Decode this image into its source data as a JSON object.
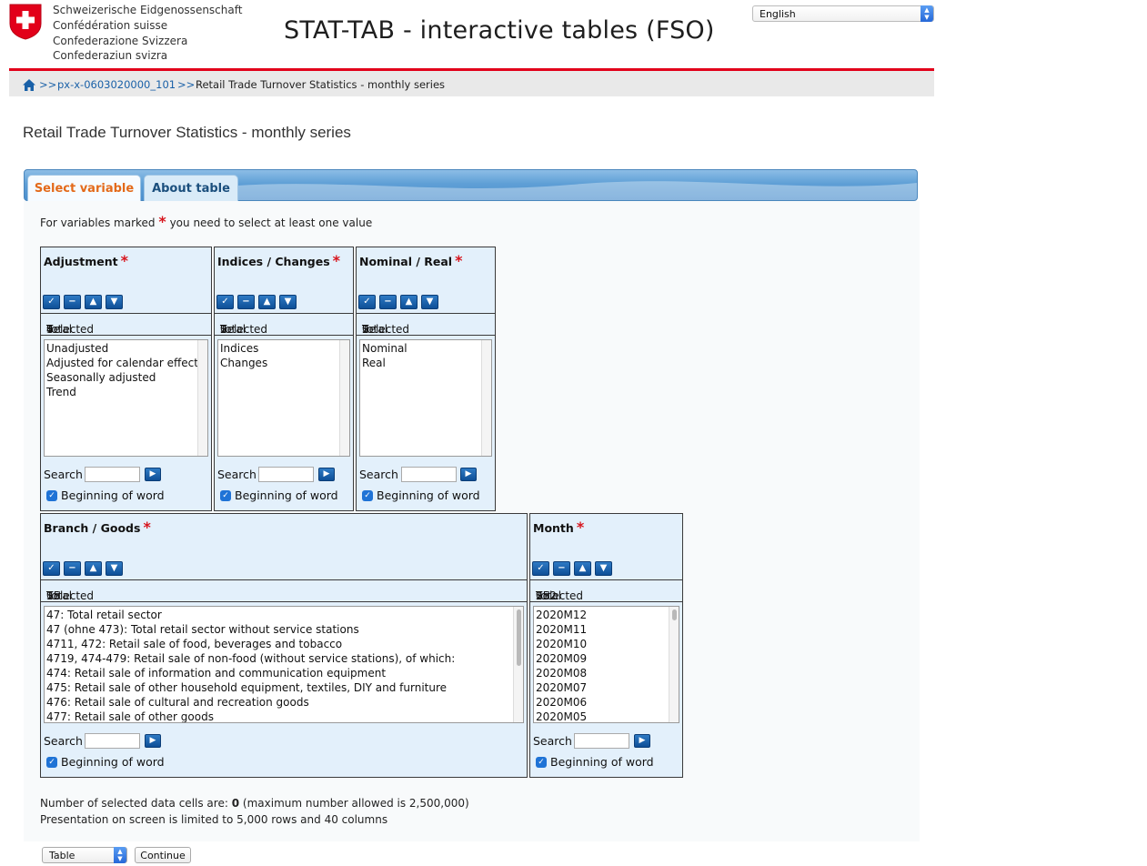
{
  "header": {
    "confederation": [
      "Schweizerische Eidgenossenschaft",
      "Confédération suisse",
      "Confederazione Svizzera",
      "Confederaziun svizra"
    ],
    "title": "STAT-TAB - interactive tables (FSO)",
    "language": "English"
  },
  "breadcrumb": {
    "sep": ">>",
    "link": "px-x-0603020000_101",
    "current": "Retail Trade Turnover Statistics - monthly series"
  },
  "page_title": "Retail Trade Turnover Statistics - monthly series",
  "tabs": [
    {
      "label": "Select variable",
      "active": true
    },
    {
      "label": "About table",
      "active": false
    }
  ],
  "note": {
    "before": "For variables marked",
    "after": "you need to select at least one value"
  },
  "required_mark": "*",
  "count_labels": {
    "total": "Total",
    "selected": "Selected"
  },
  "search_label": "Search",
  "beginning_of_word_label": "Beginning of word",
  "variables": {
    "adjustment": {
      "name": "Adjustment",
      "total": "4",
      "selected": "0",
      "values": [
        "Unadjusted",
        "Adjusted for calendar effects",
        "Seasonally adjusted",
        "Trend"
      ]
    },
    "indices": {
      "name": "Indices / Changes",
      "total": "2",
      "selected": "0",
      "values": [
        "Indices",
        "Changes"
      ]
    },
    "nominal": {
      "name": "Nominal / Real",
      "total": "2",
      "selected": "0",
      "values": [
        "Nominal",
        "Real"
      ]
    },
    "branch": {
      "name": "Branch / Goods",
      "total": "15",
      "selected": "0",
      "values": [
        "47: Total retail sector",
        "47 (ohne 473): Total retail sector without service stations",
        "4711, 472: Retail sale of food, beverages and tobacco",
        "4719, 474-479: Retail sale of non-food (without service stations), of which:",
        "474: Retail sale of information and communication equipment",
        "475: Retail sale of other household equipment, textiles, DIY and furniture",
        "476: Retail sale of cultural and recreation goods",
        "477: Retail sale of other goods"
      ]
    },
    "month": {
      "name": "Month",
      "total": "252",
      "selected": "0",
      "values": [
        "2020M12",
        "2020M11",
        "2020M10",
        "2020M09",
        "2020M08",
        "2020M07",
        "2020M06",
        "2020M05"
      ]
    }
  },
  "footer": {
    "cells_before": "Number of selected data cells are:",
    "cells_value": "0",
    "cells_after": "(maximum number allowed is 2,500,000)",
    "limit": "Presentation on screen is limited to 5,000 rows and 40 columns",
    "output_format": "Table",
    "continue_label": "Continue"
  },
  "colors": {
    "accent_red": "#e2001a",
    "link": "#1a61a8",
    "tab_active_text": "#e36a1a",
    "panel_bg": "#e3f0fb"
  }
}
